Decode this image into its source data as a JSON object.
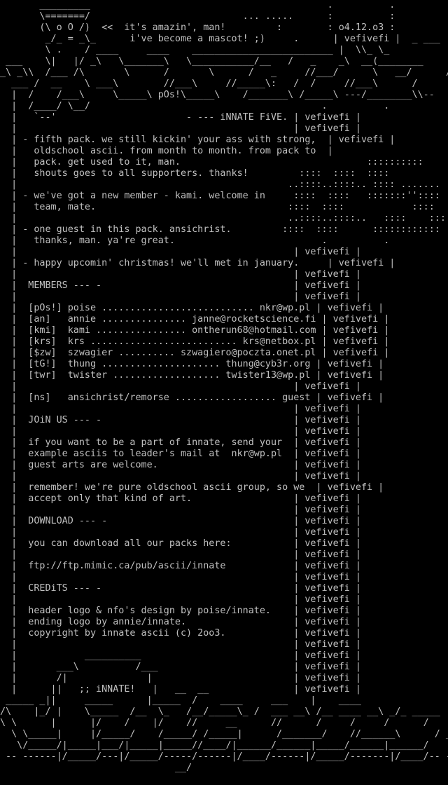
{
  "app": {
    "title": "iNNATE FiVE",
    "colors": {
      "background": "#000000",
      "text": "#c0c0c0"
    }
  },
  "document": {
    "lines": [
      "       _________                                          .          .",
      "       \\=======/                           ... .....      :          :",
      "       (\\ o O /)  <<  it's amazin', man!         :        : o4.12.o3 :",
      "        _/_ = _\\_      i've become a mascot! ;)     .      | vefivefi |  _ ___",
      "        \\ .    / ____     ____    _________________________ |  \\\\_ \\_",
      " ___    \\|   |/ _\\   \\_______\\   \\___________/__   /   _    _\\  __(________",
      "_\\ _\\\\  /___ /\\       \\      /       \\      /   _     //___/      \\   __/      /",
      "  ___ /  __    \\ ___\\        //___\\     //_____\\:   /  /     //___\\      /",
      "  |  /    /___\\     \\_____\\ pOs!\\_____\\    /_______\\ /_____\\ ---/________\\\\--",
      "  |  /____/ \\__/                                         .          .",
      "  |   `--'                       - --- iNNATE FiVE. | vefivefi |",
      "  |                                                 | vefivefi |",
      "  | - fifth pack. we still kickin' your ass with strong,  | vefivefi |",
      "  |   oldschool ascii. from month to month. from pack to  |",
      "  |   pack. get used to it, man.                                 ::::::::::",
      "  |   shouts goes to all supporters. thanks!         ::::  ::::  ::::",
      "  |                                                ..::::..::::.. :::: .......",
      "  | - we've got a new member - kami. welcome in     ::::  ::::   :::::::''::::",
      "  |   team, mate.                                  ::::  ::::            ::::",
      "  |                                                ..::::..::::..   ::::    ::::",
      "  | - one guest in this pack. ansichrist.         ::::  ::::      ::::::::::::",
      "  |   thanks, man. ya're great.                          .          .",
      "  |                                                 | vefivefi |",
      "  | - happy upcomin' christmas! we'll met in january.     | vefivefi |",
      "  |                                                 | vefivefi |",
      "  |  MEMBERS --- -                                  | vefivefi |",
      "  |                                                 | vefivefi |",
      "  |  [pOs!] poise ........................... nkr@wp.pl | vefivefi |",
      "  |  [an]   annie ............... janne@rocketscience.fi | vefivefi |",
      "  |  [kmi]  kami ................ ontherun68@hotmail.com | vefivefi |",
      "  |  [krs]  krs .......................... krs@netbox.pl | vefivefi |",
      "  |  [$zw]  szwagier .......... szwagiero@poczta.onet.pl | vefivefi |",
      "  |  [tG!]  thung ..................... thung@cyb3r.org | vefivefi |",
      "  |  [twr]  twister ................... twister13@wp.pl | vefivefi |",
      "  |                                                 | vefivefi |",
      "  |  [ns]   ansichrist/remorse .................. guest | vefivefi |",
      "  |                                                 | vefivefi |",
      "  |  JOiN US --- -                                  | vefivefi |",
      "  |                                                 | vefivefi |",
      "  |  if you want to be a part of innate, send your  | vefivefi |",
      "  |  example asciis to leader's mail at  nkr@wp.pl  | vefivefi |",
      "  |  guest arts are welcome.                        | vefivefi |",
      "  |                                                 | vefivefi |",
      "  |  remember! we're pure oldschool ascii group, so we  | vefivefi |",
      "  |  accept only that kind of art.                  | vefivefi |",
      "  |                                                 | vefivefi |",
      "  |  DOWNLOAD --- -                                 | vefivefi |",
      "  |                                                 | vefivefi |",
      "  |  you can download all our packs here:           | vefivefi |",
      "  |                                                 | vefivefi |",
      "  |  ftp://ftp.mimic.ca/pub/ascii/innate            | vefivefi |",
      "  |                                                 | vefivefi |",
      "  |  CREDiTS --- -                                  | vefivefi |",
      "  |                                                 | vefivefi |",
      "  |  header logo & nfo's design by poise/innate.    | vefivefi |",
      "  |  ending logo by annie/innate.                   | vefivefi |",
      "  |  copyright by innate ascii (c) 2oo3.            | vefivefi |",
      "  |                                                 | vefivefi |",
      "  |            __________                           | vefivefi |",
      "  |       ___\\          /___                        | vefivefi |",
      "  |       /|              |                         | vefivefi |",
      "  |      ||   ;; iNNATE!   |   __  __               | vefivefi |",
      " _____ _||     _____      |_____  /    ____     ___    |    ____",
      "/\\    |_/ |    \\_____  /__  \\_   /__/_____\\_ /  ___ __\\ /__ ____ __\\ _/_ _____",
      "\\ \\      |      |/    /    |/    //     __      //      /     /     /      /",
      "  \\ \\_____|     |/_____/    /_____/ /_____|      /_______/    //______\\      / _an",
      "   \\/_____/|_____|___/|_____|_____//____/|______/______|_____/______|______/",
      " -- ------|/_____/---|/_____/-----/------|/____/------|/_____/-------|/____/-- --",
      "                               __/"
    ]
  }
}
